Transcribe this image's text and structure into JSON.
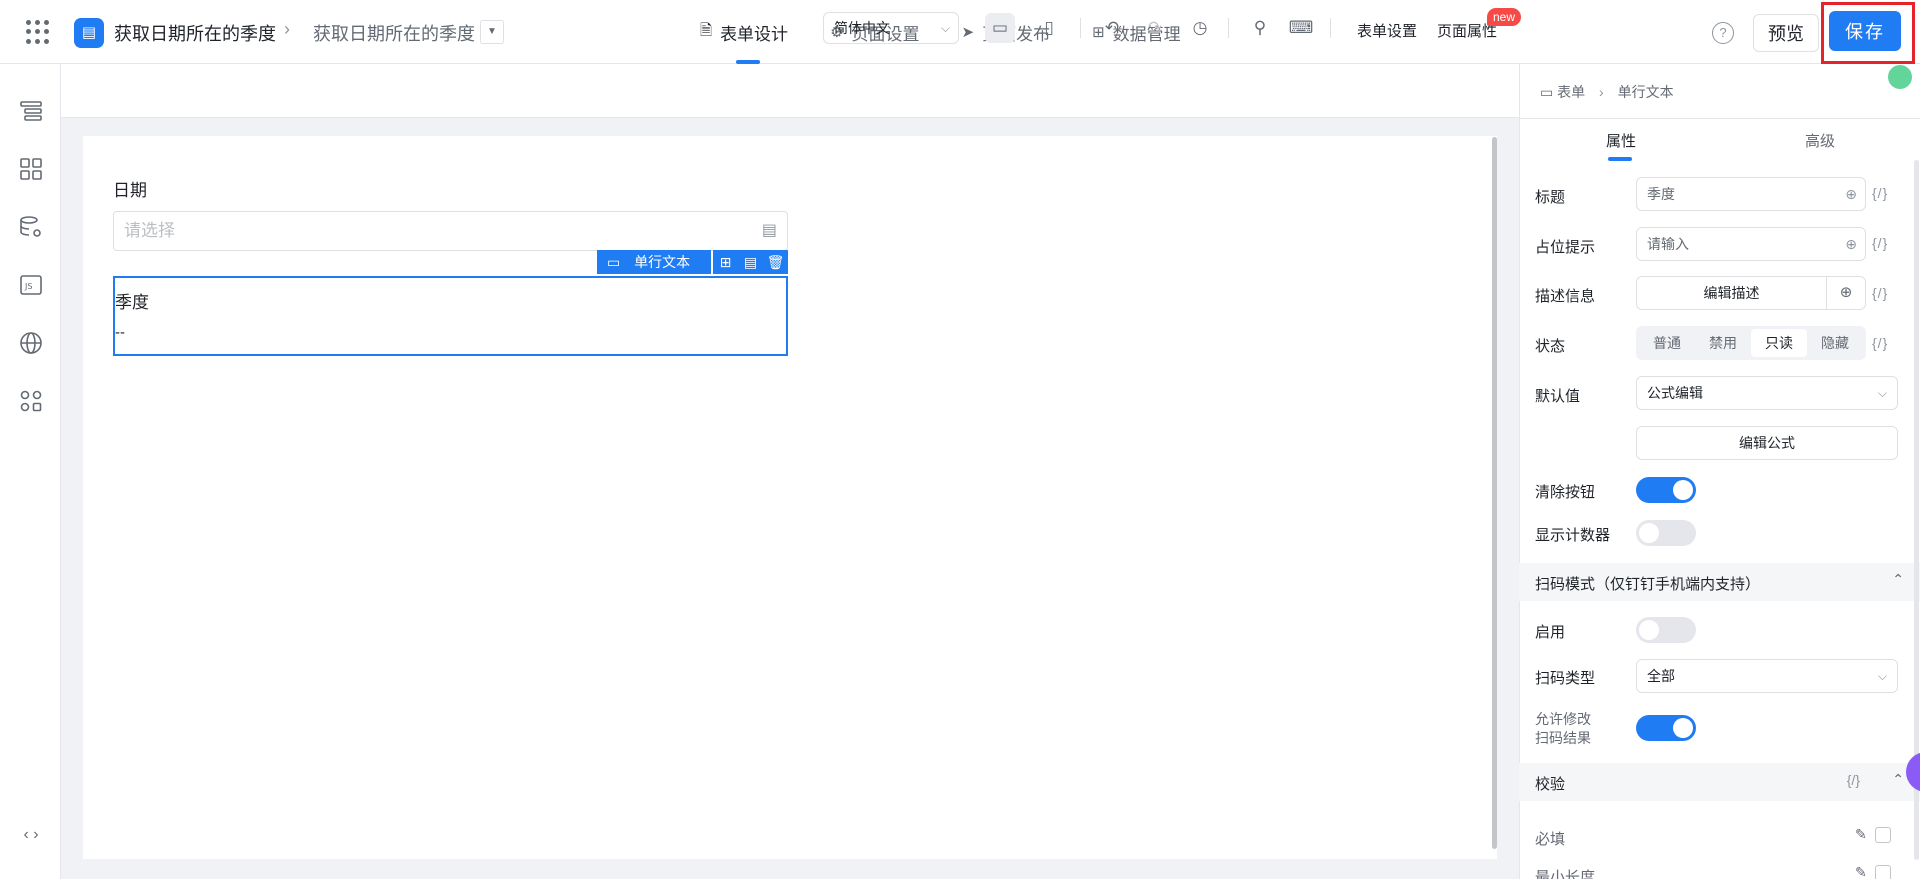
{
  "header": {
    "app_title": "获取日期所在的季度",
    "page_title": "获取日期所在的季度",
    "tabs": [
      {
        "label": "表单设计",
        "icon": "document-icon"
      },
      {
        "label": "页面设置",
        "icon": "gear-icon"
      },
      {
        "label": "页面发布",
        "icon": "send-icon"
      },
      {
        "label": "数据管理",
        "icon": "table-icon"
      }
    ],
    "active_tab": "表单设计",
    "help_glyph": "?",
    "preview_label": "预览",
    "save_label": "保存"
  },
  "toolbar": {
    "language": "简体中文",
    "form_settings": "表单设置",
    "page_properties": "页面属性",
    "new_badge": "new"
  },
  "form": {
    "date_field": {
      "label": "日期",
      "placeholder": "请选择"
    },
    "selected_field": {
      "label": "季度",
      "value": "--",
      "type_tag": "单行文本"
    }
  },
  "panel": {
    "breadcrumb": [
      "表单",
      "单行文本"
    ],
    "tabs": [
      "属性",
      "高级"
    ],
    "active_tab": "属性",
    "fx": "{/}",
    "title": {
      "label": "标题",
      "value": "季度"
    },
    "placeholder": {
      "label": "占位提示",
      "value": "请输入"
    },
    "description": {
      "label": "描述信息",
      "button": "编辑描述"
    },
    "status": {
      "label": "状态",
      "options": [
        "普通",
        "禁用",
        "只读",
        "隐藏"
      ],
      "selected": "只读"
    },
    "default_value": {
      "label": "默认值",
      "value": "公式编辑",
      "button": "编辑公式"
    },
    "clear_button": {
      "label": "清除按钮",
      "on": true
    },
    "show_counter": {
      "label": "显示计数器",
      "on": false
    },
    "scan_section": "扫码模式（仅钉钉手机端内支持）",
    "scan_enable": {
      "label": "启用",
      "on": false
    },
    "scan_type": {
      "label": "扫码类型",
      "value": "全部"
    },
    "allow_modify": {
      "label_line1": "允许修改",
      "label_line2": "扫码结果",
      "on": true
    },
    "validation_section": "校验",
    "required": {
      "label": "必填"
    },
    "min_length": {
      "label": "最小长度"
    }
  },
  "colors": {
    "accent": "#1f7cf2",
    "highlight": "#e5232b"
  }
}
